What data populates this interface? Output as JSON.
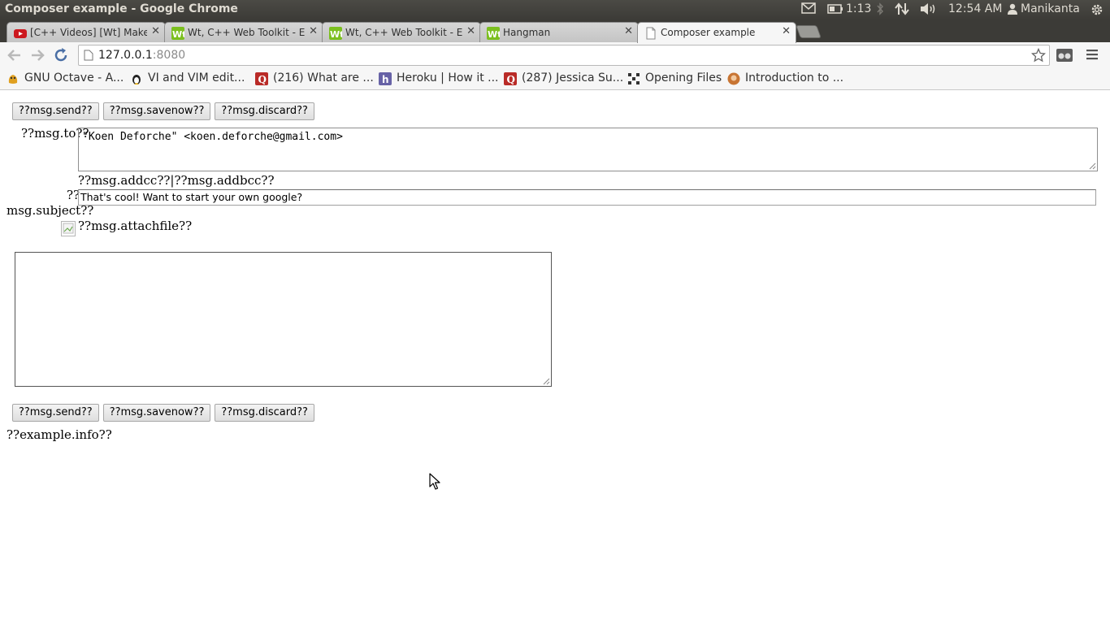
{
  "window": {
    "title": "Composer example - Google Chrome"
  },
  "system_tray": {
    "battery_time": "1:13",
    "clock": "12:54 AM",
    "user": "Manikanta",
    "icons": [
      "mail-icon",
      "battery-icon",
      "bluetooth-icon",
      "network-icon",
      "volume-icon",
      "user-icon",
      "gear-icon"
    ]
  },
  "tabs": [
    {
      "label": "[C++ Videos] [Wt] Make w",
      "favicon": "youtube-icon",
      "color": "#cc181e"
    },
    {
      "label": "Wt, C++ Web Toolkit - Exa",
      "favicon": "wt-icon",
      "color": "#7bbf1e"
    },
    {
      "label": "Wt, C++ Web Toolkit - Exa",
      "favicon": "wt-icon",
      "color": "#7bbf1e"
    },
    {
      "label": "Hangman",
      "favicon": "wt-icon",
      "color": "#7bbf1e"
    },
    {
      "label": "Composer example",
      "favicon": "page-icon",
      "active": true
    }
  ],
  "address_bar": {
    "host": "127.0.0.1",
    "port": ":8080"
  },
  "bookmarks": [
    {
      "label": "GNU Octave - A...",
      "icon": "octave-icon",
      "color": "#e0a020"
    },
    {
      "label": "VI and VIM edit...",
      "icon": "tux-icon",
      "color": "#222222"
    },
    {
      "label": "(216) What are ...",
      "icon": "quora-icon",
      "color": "#b92b27"
    },
    {
      "label": "Heroku | How it ...",
      "icon": "heroku-icon",
      "color": "#6762a6"
    },
    {
      "label": "(287) Jessica Su...",
      "icon": "quora-icon",
      "color": "#b92b27"
    },
    {
      "label": "Opening Files",
      "icon": "pattern-icon",
      "color": "#333333"
    },
    {
      "label": "Introduction to ...",
      "icon": "avatar-icon",
      "color": "#c87533"
    }
  ],
  "composer": {
    "buttons_top": {
      "send": "??msg.send??",
      "savenow": "??msg.savenow??",
      "discard": "??msg.discard??"
    },
    "to_label": "??msg.to??",
    "to_value": "\"Koen Deforche\" <koen.deforche@gmail.com>",
    "addcc": "??msg.addcc??",
    "separator": "|",
    "addbcc": "??msg.addbcc??",
    "subject_label_line1": "??",
    "subject_label_line2": "msg.subject??",
    "subject_value": "That's cool! Want to start your own google?",
    "attach_label": "??msg.attachfile??",
    "body_value": "",
    "buttons_bottom": {
      "send": "??msg.send??",
      "savenow": "??msg.savenow??",
      "discard": "??msg.discard??"
    },
    "info": "??example.info??"
  }
}
